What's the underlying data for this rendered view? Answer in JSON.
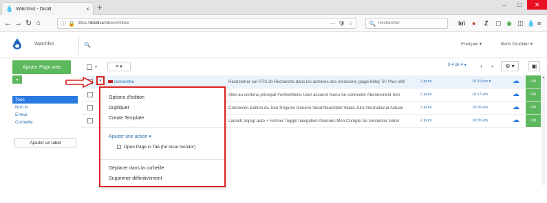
{
  "browser": {
    "tab_title": "Watchlist - Distill",
    "tab_close": "×",
    "new_tab": "+",
    "url_prefix": "https://",
    "url_domain": "distill.io",
    "url_path": "/inbox/#/inbox",
    "url_menu": "···",
    "search_placeholder": "Rechercher",
    "min": "–",
    "max": "□",
    "close": "✕"
  },
  "app": {
    "name": "Watchlist",
    "search_icon": "search-icon",
    "language": "Français ▾",
    "user": "Boris Druckler ▾",
    "logo_color": "#1e63b8"
  },
  "sidebar": {
    "add_button": "Ajouter Page web",
    "add_dropdown": "▾",
    "filters": [
      {
        "label": "Tous"
      },
      {
        "label": "Non lu"
      },
      {
        "label": "Erreur"
      },
      {
        "label": "Corbeille"
      }
    ],
    "add_label": "Ajouter un label"
  },
  "toolbar": {
    "menu_icon": "≡ ▾",
    "pager": "0-4 de 4 ▾",
    "prev": "‹",
    "next": "›",
    "settings": "⚙ ▾",
    "save": "▣"
  },
  "rows": [
    {
      "name": "recherche",
      "desc": "Rechercher sur RTS.ch Recherche dans les archives des émissions (page bêta) Tri: Plus réfé",
      "age": "2 jours",
      "time": "10:19 am ▾",
      "status": "ON"
    },
    {
      "name": "",
      "desc": "Aller au contenu principal FermerMenu User account menu Se connecter Abonnement Sen",
      "age": "2 jours",
      "time": "10:17 am",
      "status": "ON"
    },
    {
      "name": "",
      "desc": "Connexion Édition du Jour Régions Genève Vaud Neuchâtel Valais Jura International Actuali",
      "age": "2 jours",
      "time": "10:06 am",
      "status": "ON"
    },
    {
      "name": "",
      "desc": "Launch popup auto × Fermer Toggle navigation Abonnés Mon Compte Se connecter  Gérer",
      "age": "2 jours",
      "time": "10:05 am",
      "status": "ON"
    }
  ],
  "dropdown": {
    "items_top": [
      "Options d'édition",
      "Dupliquer",
      "Create Template"
    ],
    "add_action": "Ajouter une action ▾",
    "action": "Open Page in Tab (for local monitor)",
    "items_bottom": [
      "Déplacer dans la corbeille",
      "Supprimer définitivement"
    ]
  },
  "colors": {
    "green": "#5cb85c",
    "blue": "#2a7ae2",
    "annotation_red": "#d22"
  }
}
